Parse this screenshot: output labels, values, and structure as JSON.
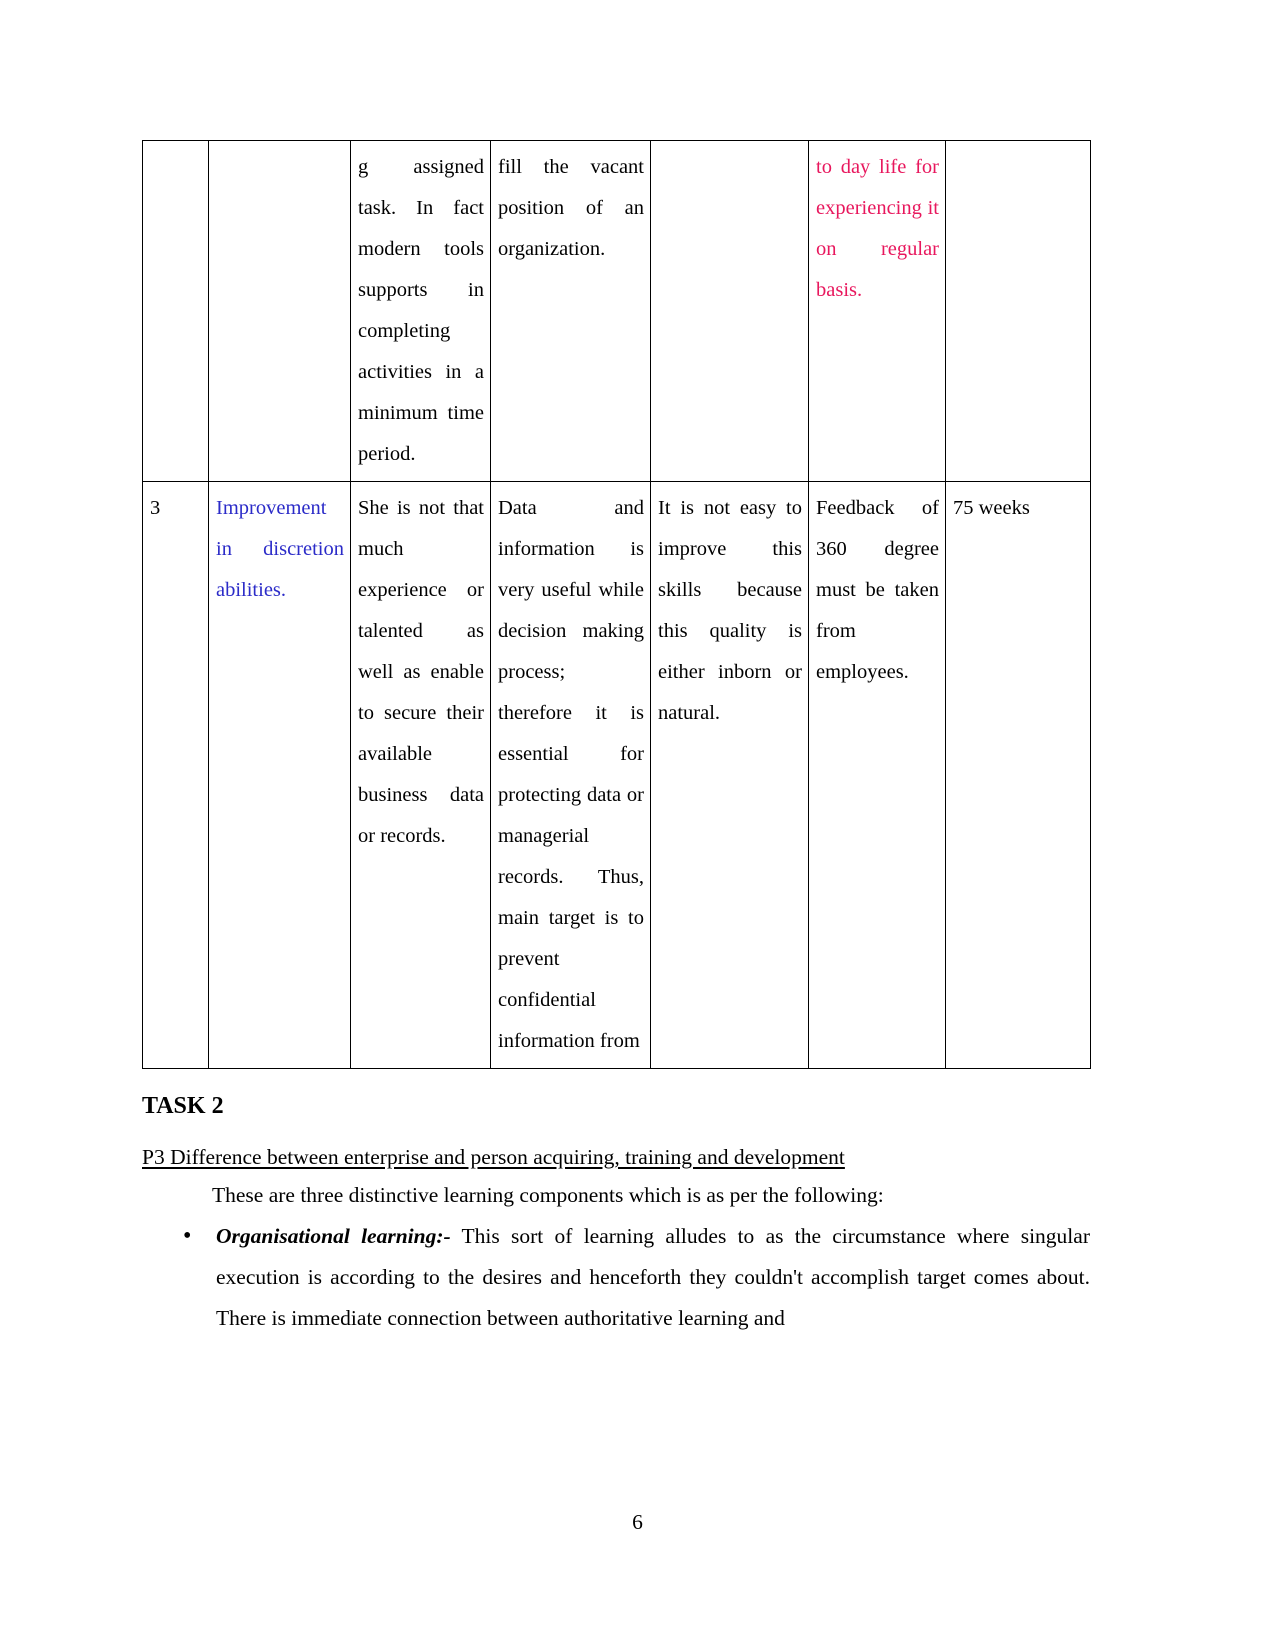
{
  "document": {
    "page_number": "6",
    "colors": {
      "pink": "#E8175D",
      "blue": "#2B2BC8",
      "text": "#000000",
      "border": "#000000"
    }
  },
  "table": {
    "rows": [
      {
        "cells": [
          {
            "text": "",
            "style": "plain"
          },
          {
            "text": "",
            "style": "plain"
          },
          {
            "text": "g assigned task. In fact modern tools supports in completing activities in a minimum time period.",
            "style": "justify"
          },
          {
            "text": "fill the vacant position of an organization.",
            "style": "justify"
          },
          {
            "text": "",
            "style": "plain"
          },
          {
            "text": "to day life for experiencing it on regular basis.",
            "style": "pink"
          },
          {
            "text": "",
            "style": "plain"
          }
        ]
      },
      {
        "cells": [
          {
            "text": "3",
            "style": "plain"
          },
          {
            "text": "Improvement in discretion abilities.",
            "style": "blue"
          },
          {
            "text": "She is not that much experience or talented as well as enable to secure their available business data or records.",
            "style": "justify"
          },
          {
            "text": "Data and information is very useful while decision making process; therefore it is essential for protecting data or managerial records. Thus, main target is to prevent confidential information from",
            "style": "justify"
          },
          {
            "text": "It is not easy to improve this skills because this quality is either inborn or natural.",
            "style": "justify"
          },
          {
            "text": "Feedback of 360 degree must be taken from employees.",
            "style": "justify"
          },
          {
            "text": "75 weeks",
            "style": "last"
          }
        ]
      }
    ]
  },
  "content": {
    "task_heading": "TASK 2",
    "p3_heading": "P3 Difference between enterprise and person acquiring, training and development",
    "intro_paragraph": "These are three distinctive learning components which is as per the following:",
    "bullets": [
      {
        "marker": "•",
        "lead": "Organisational learning:-",
        "body": " This sort of learning alludes to as the circumstance where singular execution is according to the desires and henceforth they couldn't accomplish target comes about. There is immediate connection between authoritative learning and"
      }
    ]
  }
}
